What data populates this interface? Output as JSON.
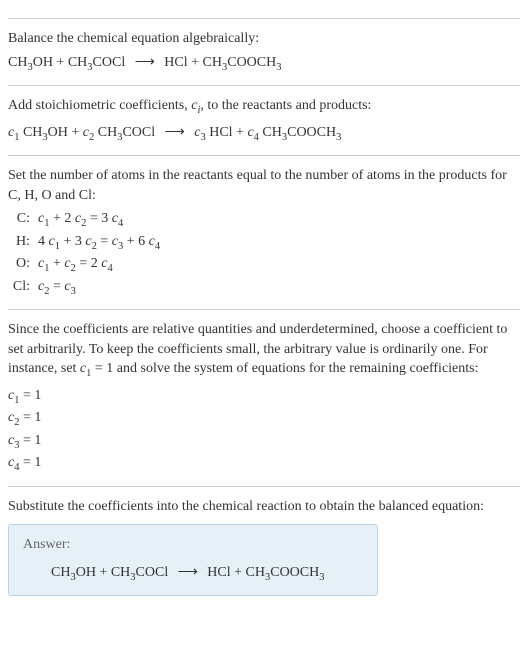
{
  "sec1": {
    "title": "Balance the chemical equation algebraically:",
    "eq_lhs1": "CH",
    "eq_lhs1_sub": "3",
    "eq_lhs1b": "OH + CH",
    "eq_lhs1b_sub": "3",
    "eq_lhs1c": "COCl",
    "arrow": "⟶",
    "eq_rhs1": "HCl + CH",
    "eq_rhs1_sub": "3",
    "eq_rhs1b": "COOCH",
    "eq_rhs1b_sub": "3"
  },
  "sec2": {
    "title_a": "Add stoichiometric coefficients, ",
    "title_ci": "c",
    "title_ci_sub": "i",
    "title_b": ", to the reactants and products:",
    "c1": "c",
    "c1_sub": "1",
    "sp1a": " CH",
    "sp1a_sub": "3",
    "sp1b": "OH + ",
    "c2": "c",
    "c2_sub": "2",
    "sp2a": " CH",
    "sp2a_sub": "3",
    "sp2b": "COCl",
    "arrow": "⟶",
    "c3": "c",
    "c3_sub": "3",
    "sp3a": " HCl + ",
    "c4": "c",
    "c4_sub": "4",
    "sp4a": " CH",
    "sp4a_sub": "3",
    "sp4b": "COOCH",
    "sp4b_sub": "3"
  },
  "sec3": {
    "title": "Set the number of atoms in the reactants equal to the number of atoms in the products for C, H, O and Cl:",
    "rows": {
      "C": {
        "label": "C:",
        "eq_a": "c",
        "s1": "1",
        "eq_b": " + 2 ",
        "eq_c": "c",
        "s2": "2",
        "eq_d": " = 3 ",
        "eq_e": "c",
        "s4": "4"
      },
      "H": {
        "label": "H:",
        "eq_a": "4 ",
        "eq_b": "c",
        "s1": "1",
        "eq_c": " + 3 ",
        "eq_d": "c",
        "s2": "2",
        "eq_e": " = ",
        "eq_f": "c",
        "s3": "3",
        "eq_g": " + 6 ",
        "eq_h": "c",
        "s4": "4"
      },
      "O": {
        "label": "O:",
        "eq_a": "c",
        "s1": "1",
        "eq_b": " + ",
        "eq_c": "c",
        "s2": "2",
        "eq_d": " = 2 ",
        "eq_e": "c",
        "s4": "4"
      },
      "Cl": {
        "label": "Cl:",
        "eq_a": "c",
        "s2": "2",
        "eq_b": " = ",
        "eq_c": "c",
        "s3": "3"
      }
    }
  },
  "sec4": {
    "title_a": "Since the coefficients are relative quantities and underdetermined, choose a coefficient to set arbitrarily. To keep the coefficients small, the arbitrary value is ordinarily one. For instance, set ",
    "title_c": "c",
    "title_c_sub": "1",
    "title_b": " = 1 and solve the system of equations for the remaining coefficients:",
    "lines": {
      "l1": {
        "c": "c",
        "sub": "1",
        "eq": " = 1"
      },
      "l2": {
        "c": "c",
        "sub": "2",
        "eq": " = 1"
      },
      "l3": {
        "c": "c",
        "sub": "3",
        "eq": " = 1"
      },
      "l4": {
        "c": "c",
        "sub": "4",
        "eq": " = 1"
      }
    }
  },
  "sec5": {
    "title": "Substitute the coefficients into the chemical reaction to obtain the balanced equation:",
    "answer_label": "Answer:",
    "eq_lhs1": "CH",
    "eq_lhs1_sub": "3",
    "eq_lhs1b": "OH + CH",
    "eq_lhs1b_sub": "3",
    "eq_lhs1c": "COCl",
    "arrow": "⟶",
    "eq_rhs1": "HCl + CH",
    "eq_rhs1_sub": "3",
    "eq_rhs1b": "COOCH",
    "eq_rhs1b_sub": "3"
  }
}
